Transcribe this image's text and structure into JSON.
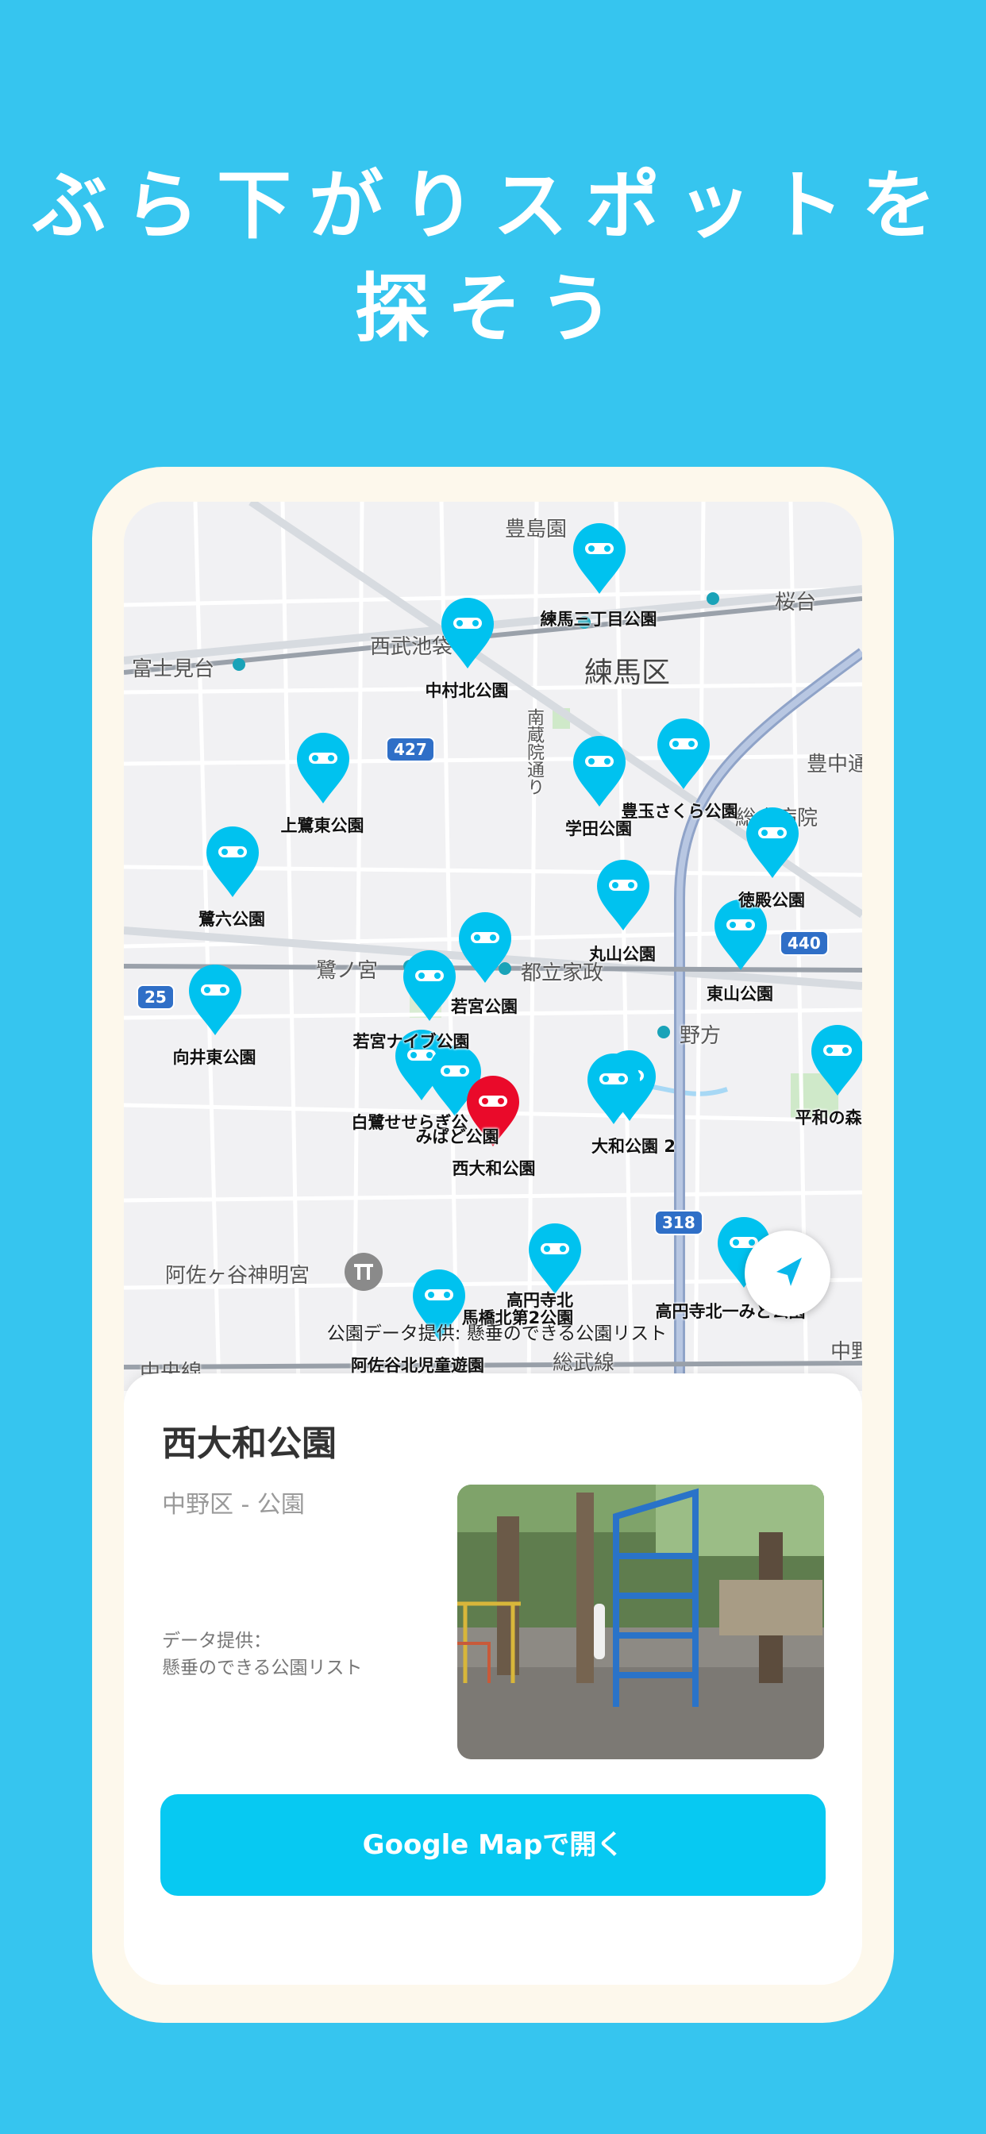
{
  "headline": {
    "line1": "ぶら下がりスポットを",
    "line2": "探そう"
  },
  "map": {
    "area_labels": [
      {
        "text": "豊島園"
      },
      {
        "text": "桜台"
      },
      {
        "text": "富士見台"
      },
      {
        "text": "西武池袋"
      },
      {
        "text": "練馬区"
      },
      {
        "text": "南蔵院通り"
      },
      {
        "text": "豊中通"
      },
      {
        "text": "総合病院"
      },
      {
        "text": "鷺ノ宮"
      },
      {
        "text": "都立家政"
      },
      {
        "text": "野方"
      },
      {
        "text": "阿佐ヶ谷神明宮"
      },
      {
        "text": "中央線"
      },
      {
        "text": "総武線"
      },
      {
        "text": "中野"
      }
    ],
    "road_numbers": [
      "427",
      "25",
      "440",
      "318"
    ],
    "poi_labels": [
      "練馬三丁目公園",
      "中村北公園",
      "上鷺東公園",
      "学田公園",
      "豊玉さくら公園",
      "鷺六公園",
      "徳殿公園",
      "丸山公園",
      "東山公園",
      "若宮公園",
      "向井東公園",
      "若宮ナイブ公園",
      "平和の森公",
      "白鷺せせらぎ公",
      "みぱど公園",
      "西大和公園",
      "大和公園 2",
      "高円寺北",
      "馬橋北第2公園",
      "高円寺北一みど公園",
      "阿佐谷北児童遊園"
    ],
    "attribution": "公園データ提供: 懸垂のできる公園リスト",
    "pin_color": "#00c2ef",
    "selected_pin_color": "#ea0a2a"
  },
  "detail": {
    "name": "西大和公園",
    "category": "中野区 - 公園",
    "credit_line1": "データ提供：",
    "credit_line2": "懸垂のできる公園リスト",
    "button_label": "Google Mapで開く"
  },
  "colors": {
    "background": "#36c5ef",
    "frame": "#fdf8ec",
    "button": "#07c9f2"
  }
}
